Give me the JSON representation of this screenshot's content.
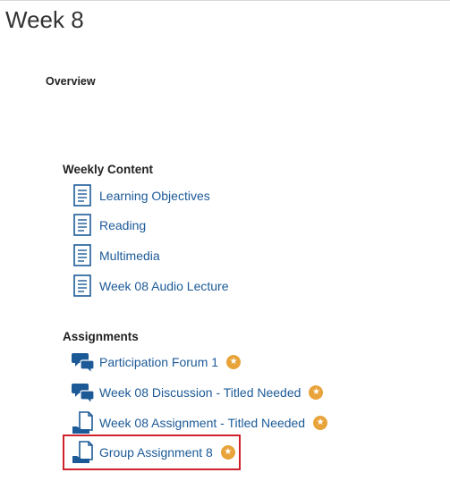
{
  "page": {
    "title": "Week 8"
  },
  "overview": {
    "label": "Overview"
  },
  "weekly_content": {
    "heading": "Weekly Content",
    "items": [
      {
        "label": "Learning Objectives",
        "icon": "document-icon"
      },
      {
        "label": "Reading",
        "icon": "document-icon"
      },
      {
        "label": "Multimedia",
        "icon": "document-icon"
      },
      {
        "label": "Week 08 Audio Lecture",
        "icon": "document-icon"
      }
    ]
  },
  "assignments": {
    "heading": "Assignments",
    "items": [
      {
        "label": "Participation Forum 1",
        "icon": "discussion-icon",
        "badge": "star-badge-icon"
      },
      {
        "label": "Week 08 Discussion - Titled Needed",
        "icon": "discussion-icon",
        "badge": "star-badge-icon"
      },
      {
        "label": "Week 08 Assignment - Titled Needed",
        "icon": "assignment-submit-icon",
        "badge": "star-badge-icon"
      },
      {
        "label": "Group Assignment 8",
        "icon": "assignment-submit-icon",
        "badge": "star-badge-icon",
        "highlighted": true
      }
    ]
  },
  "colors": {
    "link": "#1c5a97",
    "icon": "#1c5a97",
    "badge": "#e8a33b",
    "highlight": "#d0212b"
  }
}
